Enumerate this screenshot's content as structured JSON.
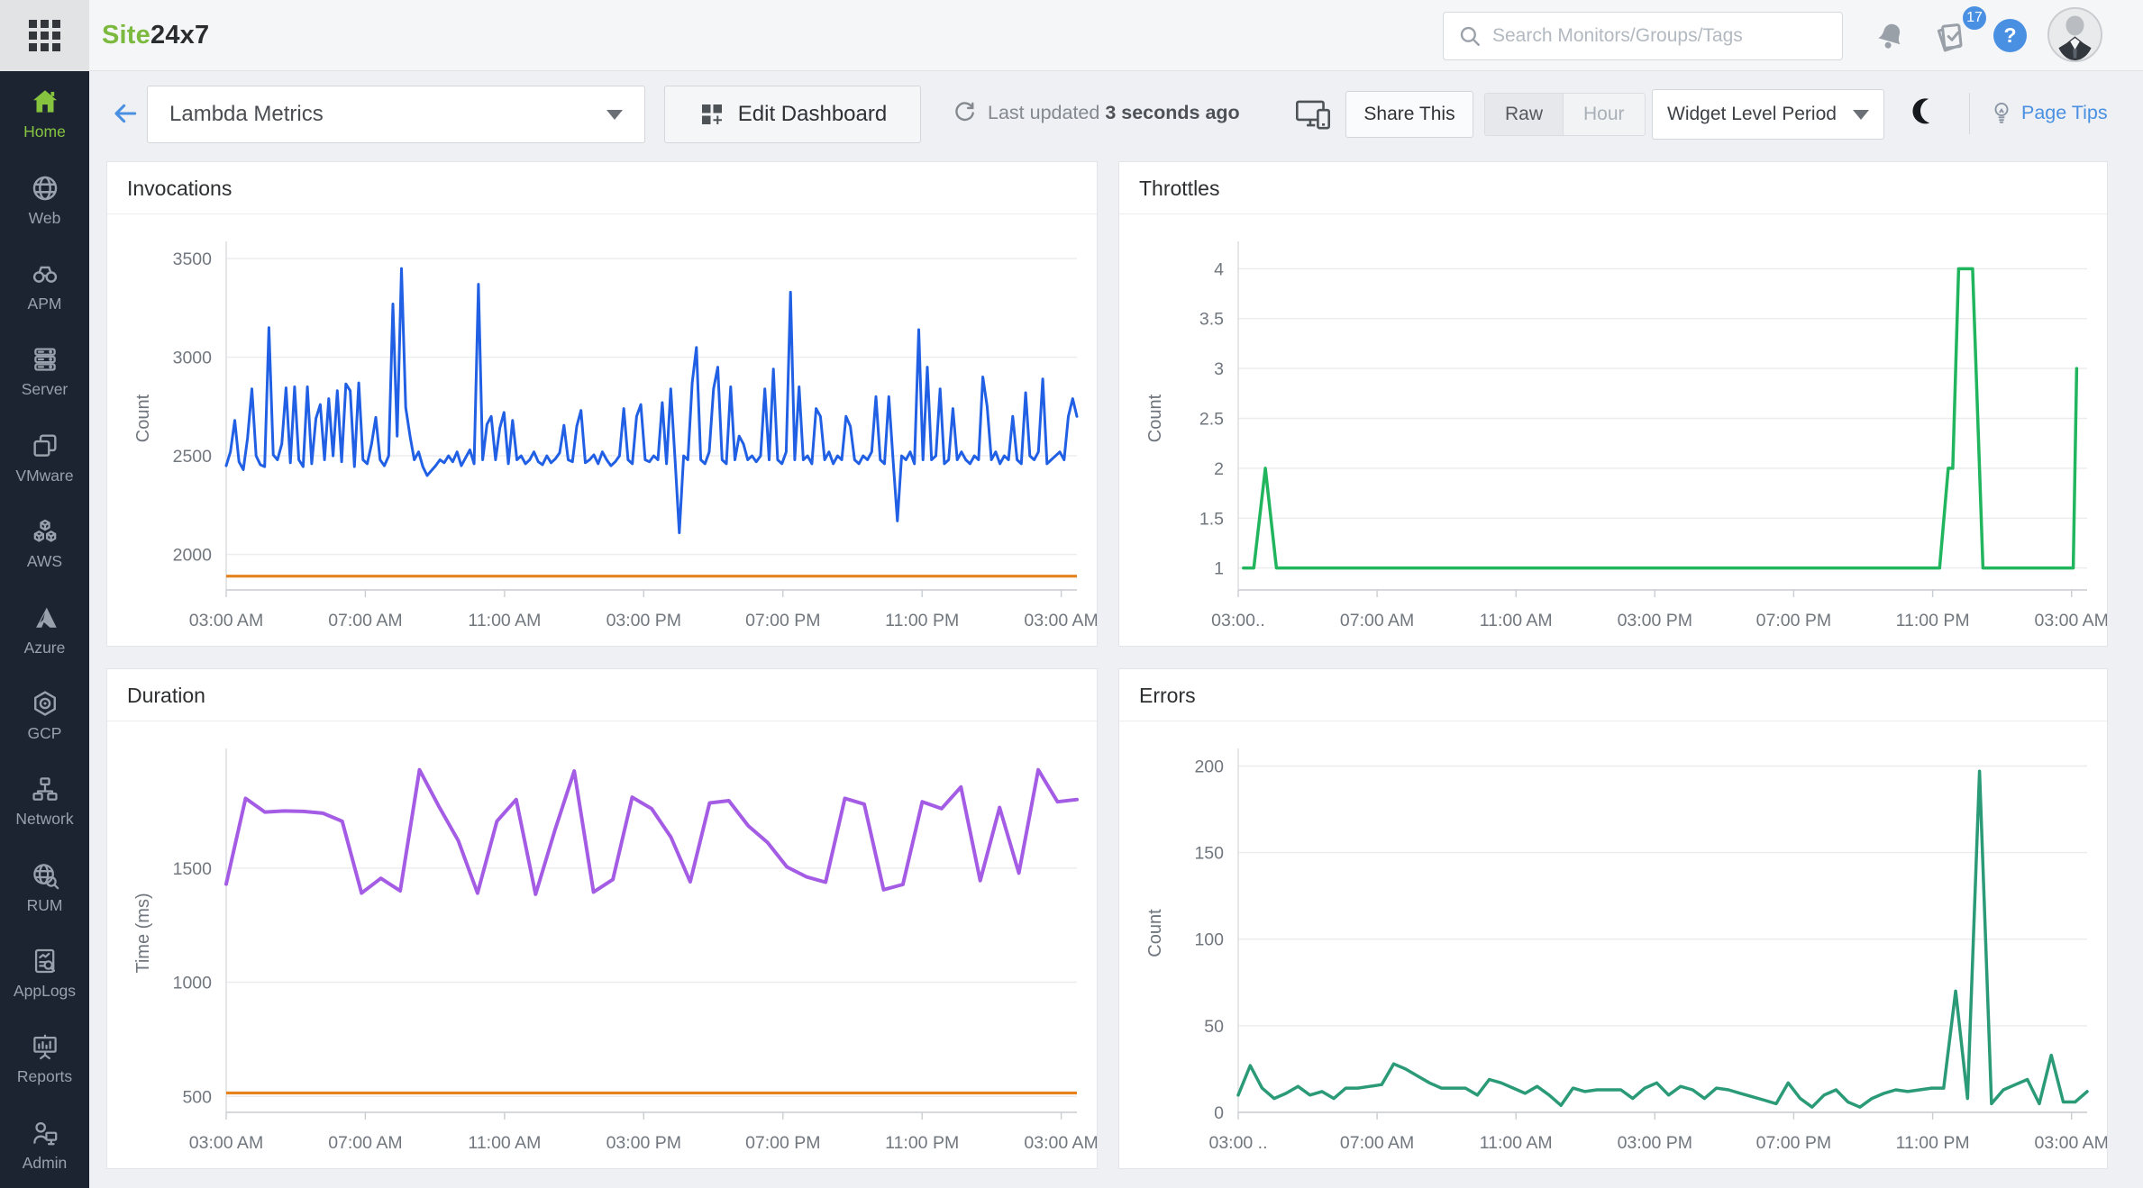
{
  "topbar": {
    "logo_site": "Site",
    "logo_247": "24x7",
    "search_placeholder": "Search Monitors/Groups/Tags",
    "notifications_badge": "17",
    "help_label": "?",
    "brand_green": "#7cb93f"
  },
  "sidebar": {
    "active_color": "#86c440",
    "items": [
      {
        "label": "Home",
        "active": true
      },
      {
        "label": "Web"
      },
      {
        "label": "APM"
      },
      {
        "label": "Server"
      },
      {
        "label": "VMware"
      },
      {
        "label": "AWS"
      },
      {
        "label": "Azure"
      },
      {
        "label": "GCP"
      },
      {
        "label": "Network"
      },
      {
        "label": "RUM"
      },
      {
        "label": "AppLogs"
      },
      {
        "label": "Reports"
      },
      {
        "label": "Admin"
      }
    ]
  },
  "toolbar": {
    "dashboard_name": "Lambda Metrics",
    "edit_dashboard_label": "Edit Dashboard",
    "last_updated_prefix": "Last updated",
    "last_updated_value": "3 seconds ago",
    "share_label": "Share This",
    "granularity": {
      "options": [
        "Raw",
        "Hour"
      ],
      "selected": "Raw"
    },
    "period_label": "Widget Level Period",
    "page_tips_label": "Page Tips"
  },
  "chart_data": [
    {
      "type": "line",
      "title": "Invocations",
      "ylabel": "Count",
      "color": "#2160e4",
      "line_width": 3,
      "threshold": {
        "value": 1890,
        "color": "#e5821e"
      },
      "ylim": [
        1820,
        3560
      ],
      "yticks": [
        2000,
        2500,
        3000,
        3500
      ],
      "x_range": [
        3,
        27.45
      ],
      "xticks": [
        {
          "x": 3,
          "label": "03:00 AM"
        },
        {
          "x": 7,
          "label": "07:00 AM"
        },
        {
          "x": 11,
          "label": "11:00 AM"
        },
        {
          "x": 15,
          "label": "03:00 PM"
        },
        {
          "x": 19,
          "label": "07:00 PM"
        },
        {
          "x": 23,
          "label": "11:00 PM"
        },
        {
          "x": 27,
          "label": "03:00 AM"
        }
      ],
      "values": [
        2450,
        2520,
        2680,
        2470,
        2430,
        2590,
        2840,
        2500,
        2455,
        2445,
        3150,
        2505,
        2480,
        2560,
        2845,
        2465,
        2850,
        2480,
        2445,
        2850,
        2460,
        2690,
        2760,
        2480,
        2790,
        2500,
        2830,
        2470,
        2865,
        2830,
        2445,
        2870,
        2480,
        2460,
        2560,
        2695,
        2480,
        2450,
        2500,
        3270,
        2600,
        3450,
        2745,
        2600,
        2480,
        2520,
        2445,
        2400,
        2425,
        2450,
        2480,
        2465,
        2500,
        2470,
        2520,
        2450,
        2490,
        2530,
        2460,
        3370,
        2480,
        2660,
        2700,
        2480,
        2640,
        2720,
        2460,
        2680,
        2480,
        2500,
        2460,
        2480,
        2520,
        2470,
        2455,
        2500,
        2465,
        2485,
        2515,
        2655,
        2480,
        2470,
        2650,
        2730,
        2465,
        2480,
        2505,
        2460,
        2520,
        2480,
        2450,
        2470,
        2500,
        2740,
        2480,
        2460,
        2700,
        2760,
        2480,
        2470,
        2500,
        2480,
        2770,
        2460,
        2840,
        2480,
        2110,
        2500,
        2480,
        2870,
        3050,
        2480,
        2460,
        2520,
        2840,
        2950,
        2480,
        2460,
        2850,
        2480,
        2600,
        2560,
        2480,
        2500,
        2470,
        2500,
        2840,
        2480,
        2940,
        2480,
        2460,
        2520,
        3330,
        2480,
        2850,
        2480,
        2500,
        2460,
        2740,
        2700,
        2480,
        2520,
        2460,
        2500,
        2480,
        2700,
        2650,
        2480,
        2460,
        2500,
        2480,
        2520,
        2800,
        2480,
        2460,
        2800,
        2480,
        2170,
        2500,
        2480,
        2520,
        2460,
        3140,
        2480,
        2950,
        2480,
        2500,
        2840,
        2460,
        2480,
        2740,
        2480,
        2520,
        2480,
        2460,
        2500,
        2480,
        2900,
        2750,
        2480,
        2520,
        2460,
        2500,
        2480,
        2700,
        2480,
        2460,
        2820,
        2500,
        2480,
        2520,
        2890,
        2460,
        2480,
        2500,
        2520,
        2480,
        2700,
        2790,
        2700
      ]
    },
    {
      "type": "line",
      "title": "Throttles",
      "ylabel": "Count",
      "color": "#21b55e",
      "line_width": 3.5,
      "ylim": [
        0.78,
        4.22
      ],
      "yticks": [
        1,
        1.5,
        2,
        2.5,
        3,
        3.5,
        4
      ],
      "x_range": [
        3,
        27.45
      ],
      "xticks": [
        {
          "x": 3,
          "label": "03:00.."
        },
        {
          "x": 7,
          "label": "07:00 AM"
        },
        {
          "x": 11,
          "label": "11:00 AM"
        },
        {
          "x": 15,
          "label": "03:00 PM"
        },
        {
          "x": 19,
          "label": "07:00 PM"
        },
        {
          "x": 23,
          "label": "11:00 PM"
        },
        {
          "x": 27,
          "label": "03:00 AM"
        }
      ],
      "points": [
        [
          3.15,
          1
        ],
        [
          3.45,
          1
        ],
        [
          3.78,
          2
        ],
        [
          4.1,
          1
        ],
        [
          4.4,
          1
        ],
        [
          23.2,
          1
        ],
        [
          23.45,
          2
        ],
        [
          23.58,
          2
        ],
        [
          23.75,
          4
        ],
        [
          24.15,
          4
        ],
        [
          24.45,
          1
        ],
        [
          26.6,
          1
        ],
        [
          27.05,
          1
        ],
        [
          27.15,
          3
        ]
      ]
    },
    {
      "type": "line",
      "title": "Duration",
      "ylabel": "Time (ms)",
      "color": "#a55ce5",
      "line_width": 4,
      "threshold": {
        "value": 515,
        "color": "#e5821e"
      },
      "ylim": [
        430,
        2000
      ],
      "yticks": [
        500,
        1000,
        1500
      ],
      "x_range": [
        3,
        27.45
      ],
      "xticks": [
        {
          "x": 3,
          "label": "03:00 AM"
        },
        {
          "x": 7,
          "label": "07:00 AM"
        },
        {
          "x": 11,
          "label": "11:00 AM"
        },
        {
          "x": 15,
          "label": "03:00 PM"
        },
        {
          "x": 19,
          "label": "07:00 PM"
        },
        {
          "x": 23,
          "label": "11:00 PM"
        },
        {
          "x": 27,
          "label": "03:00 AM"
        }
      ],
      "values": [
        1430,
        1805,
        1745,
        1750,
        1748,
        1740,
        1705,
        1390,
        1455,
        1400,
        1930,
        1770,
        1620,
        1390,
        1705,
        1800,
        1385,
        1665,
        1925,
        1395,
        1450,
        1810,
        1760,
        1635,
        1440,
        1785,
        1795,
        1685,
        1612,
        1505,
        1462,
        1438,
        1805,
        1780,
        1405,
        1428,
        1790,
        1760,
        1855,
        1445,
        1765,
        1478,
        1930,
        1790,
        1800
      ]
    },
    {
      "type": "line",
      "title": "Errors",
      "ylabel": "Count",
      "color": "#2a9a77",
      "line_width": 3.5,
      "ylim": [
        0,
        207
      ],
      "yticks": [
        0,
        50,
        100,
        150,
        200
      ],
      "x_range": [
        3,
        27.45
      ],
      "xticks": [
        {
          "x": 3,
          "label": "03:00 .."
        },
        {
          "x": 7,
          "label": "07:00 AM"
        },
        {
          "x": 11,
          "label": "11:00 AM"
        },
        {
          "x": 15,
          "label": "03:00 PM"
        },
        {
          "x": 19,
          "label": "07:00 PM"
        },
        {
          "x": 23,
          "label": "11:00 PM"
        },
        {
          "x": 27,
          "label": "03:00 AM"
        }
      ],
      "values": [
        10,
        27,
        14,
        8,
        11,
        15,
        10,
        12,
        8,
        14,
        14,
        15,
        16,
        28,
        25,
        21,
        17,
        14,
        14,
        14,
        10,
        19,
        17,
        14,
        11,
        15,
        10,
        4,
        14,
        12,
        13,
        13,
        13,
        8,
        14,
        17,
        10,
        15,
        13,
        8,
        14,
        13,
        11,
        9,
        7,
        5,
        17,
        8,
        3,
        10,
        13,
        6,
        3,
        8,
        11,
        13,
        12,
        13,
        14,
        14,
        70,
        8,
        197,
        5,
        13,
        16,
        19,
        5,
        33,
        6,
        6,
        12
      ]
    }
  ]
}
